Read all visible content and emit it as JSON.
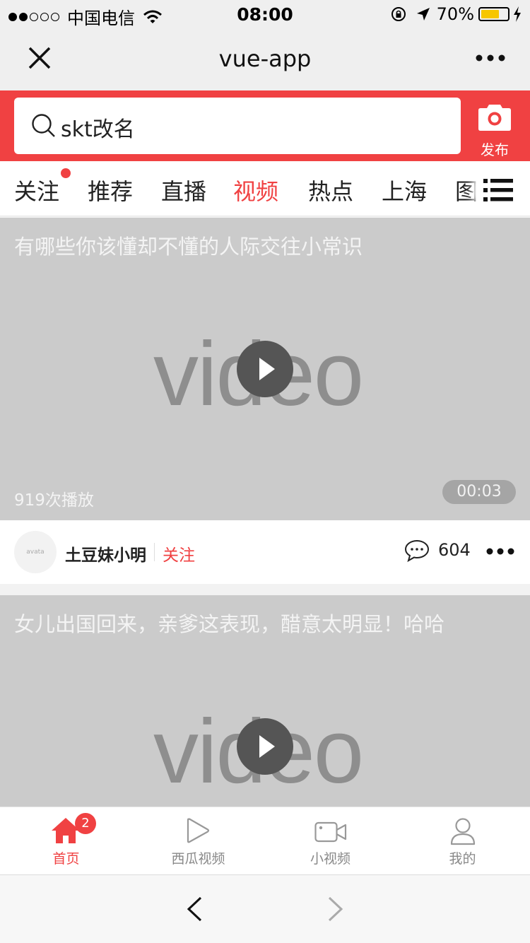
{
  "status_bar": {
    "carrier": "中国电信",
    "time": "08:00",
    "battery": "70%",
    "battery_level": 0.7,
    "signal_dots_filled": 2,
    "signal_dots_total": 5
  },
  "nav_bar": {
    "title": "vue-app"
  },
  "header": {
    "search_text": "skt改名",
    "publish_label": "发布",
    "accent_color": "#f04142"
  },
  "channels": [
    {
      "label": "关注",
      "has_dot": true,
      "active": false
    },
    {
      "label": "推荐",
      "active": false
    },
    {
      "label": "直播",
      "active": false
    },
    {
      "label": "视频",
      "active": true
    },
    {
      "label": "热点",
      "active": false
    },
    {
      "label": "上海",
      "active": false
    },
    {
      "label": "图",
      "active": false
    }
  ],
  "feed": [
    {
      "title": "有哪些你该懂却不懂的人际交往小常识",
      "watermark": "video",
      "play_count": "919次播放",
      "duration": "00:03",
      "avatar_text": "avata",
      "author": "土豆妹小明",
      "follow_label": "关注",
      "comment_count": "604"
    },
    {
      "title": "女儿出国回来，亲爹这表现，醋意太明显！哈哈",
      "watermark": "video"
    }
  ],
  "tab_bar": [
    {
      "label": "首页",
      "icon": "home-icon",
      "active": true,
      "badge": "2"
    },
    {
      "label": "西瓜视频",
      "icon": "play-outline-icon",
      "active": false
    },
    {
      "label": "小视频",
      "icon": "video-camera-icon",
      "active": false
    },
    {
      "label": "我的",
      "icon": "user-icon",
      "active": false
    }
  ]
}
